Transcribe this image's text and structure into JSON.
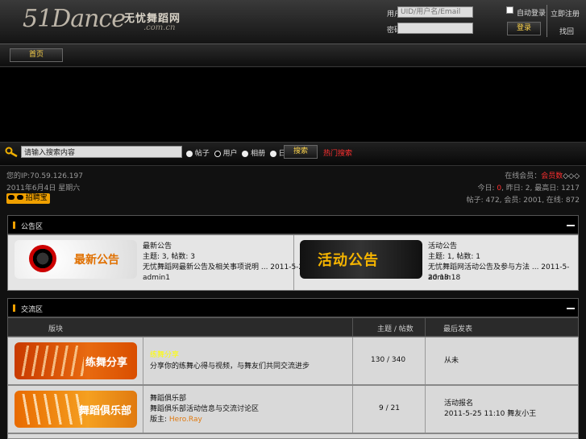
{
  "header": {
    "logo_text": "51Dance",
    "logo_cn": "无忧舞蹈网",
    "logo_domain": ".com.cn",
    "login": {
      "user_label": "用户",
      "user_placeholder": "UID/用户名/Email",
      "pass_label": "密码",
      "remember_label": "自动登录",
      "login_button": "登录",
      "register_link": "立即注册",
      "forgot_link": "找回"
    }
  },
  "nav": {
    "item": "首页"
  },
  "search": {
    "value": "请输入搜索内容",
    "options": [
      "帖子",
      "用户",
      "相册",
      "日志"
    ],
    "selected_index": 1,
    "button": "搜索",
    "hot_link": "热门搜索"
  },
  "info": {
    "ip": "您的IP:70.59.126.197",
    "date": "2011年6月4日 星期六",
    "badge": "招聘宝",
    "members_prefix": "在线会员：",
    "members_value": "会员数",
    "members_icons": "◇◇◇",
    "stats1": {
      "today_label": "今日: ",
      "today": "0",
      "yesterday_label": ", 昨日: ",
      "yesterday": "2",
      "max_label": ", 最高日: ",
      "max": "1217"
    },
    "stats2": "帖子: 472, 会员: 2001, 在线: 872"
  },
  "announce": {
    "title": "公告区",
    "items": [
      {
        "thumb": "最新公告",
        "name": "最新公告",
        "stats": "主题: 3, 帖数: 3",
        "last": "无忧舞蹈网最新公告及相关事项说明 ... 2011-5-23 20:19",
        "user": "admin1"
      },
      {
        "thumb": "活动公告",
        "name": "活动公告",
        "stats": "主题: 1, 帖数: 1",
        "last": "无忧舞蹈网活动公告及参与方法 ... 2011-5-20 18:18",
        "user": "admin"
      }
    ]
  },
  "forum": {
    "title": "交流区",
    "columns": [
      "版块",
      "主题 / 帖数",
      "最后发表"
    ],
    "rows": [
      {
        "thumb": "练舞分享",
        "name": "练舞分享",
        "desc": "分享你的练舞心得与视频，与舞友们共同交流进步",
        "mods": "",
        "counts": "130 / 340",
        "last_title": "从未",
        "last_time": "",
        "last_user": ""
      },
      {
        "thumb": "舞蹈俱乐部",
        "name": "舞蹈俱乐部",
        "desc": "舞蹈俱乐部活动信息与交流讨论区",
        "mods_label": "版主: ",
        "mods": "Hero.Ray",
        "counts": "9 / 21",
        "last_title": "活动报名",
        "last_time": "2011-5-25 11:10",
        "last_user": "舞友小王"
      }
    ]
  },
  "colors": {
    "accent": "#ffd54a",
    "red": "#ff3030",
    "orange": "#f0a000",
    "link_yellow": "#ffff00"
  }
}
